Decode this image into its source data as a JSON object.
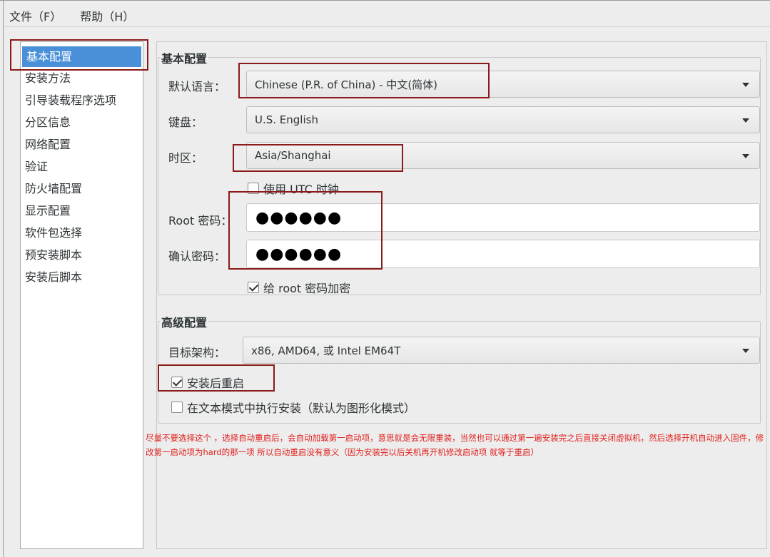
{
  "menubar": {
    "items": [
      "文件（F）",
      "帮助（H）"
    ]
  },
  "sidebar": {
    "items": [
      {
        "label": "基本配置",
        "selected": true
      },
      {
        "label": "安装方法"
      },
      {
        "label": "引导装载程序选项"
      },
      {
        "label": "分区信息"
      },
      {
        "label": "网络配置"
      },
      {
        "label": "验证"
      },
      {
        "label": "防火墙配置"
      },
      {
        "label": "显示配置"
      },
      {
        "label": "软件包选择"
      },
      {
        "label": "预安装脚本"
      },
      {
        "label": "安装后脚本"
      }
    ]
  },
  "basic": {
    "title": "基本配置",
    "language_label": "默认语言：",
    "language_value": "Chinese (P.R. of China) - 中文(简体)",
    "keyboard_label": "键盘：",
    "keyboard_value": "U.S. English",
    "timezone_label": "时区：",
    "timezone_value": "Asia/Shanghai",
    "utc_label": "使用 UTC 时钟",
    "utc_checked": false,
    "root_password_label": "Root 密码：",
    "root_password_value": "●●●●●●",
    "confirm_password_label": "确认密码：",
    "confirm_password_value": "●●●●●●",
    "encrypt_label": "给 root 密码加密",
    "encrypt_checked": true
  },
  "advanced": {
    "title": "高级配置",
    "arch_label": "目标架构：",
    "arch_value": "x86, AMD64, 或 Intel EM64T",
    "reboot_label": "安装后重启",
    "reboot_checked": true,
    "textmode_label": "在文本模式中执行安装（默认为图形化模式）",
    "textmode_checked": false
  },
  "annotation": {
    "text": "尽量不要选择这个 ，选择自动重启后，会自动加载第一启动项，意思就是会无限重装，当然也可以通过第一遍安装完之后直接关闭虚拟机，然后选择开机自动进入固件，修改第一启动项为hard的那一项  所以自动重启没有意义（因为安装完以后关机再开机修改启动项 就等于重启）",
    "color": "#e0201c"
  },
  "colors": {
    "selection": "#4a90d9",
    "highlight_box": "#8b1a1a"
  }
}
